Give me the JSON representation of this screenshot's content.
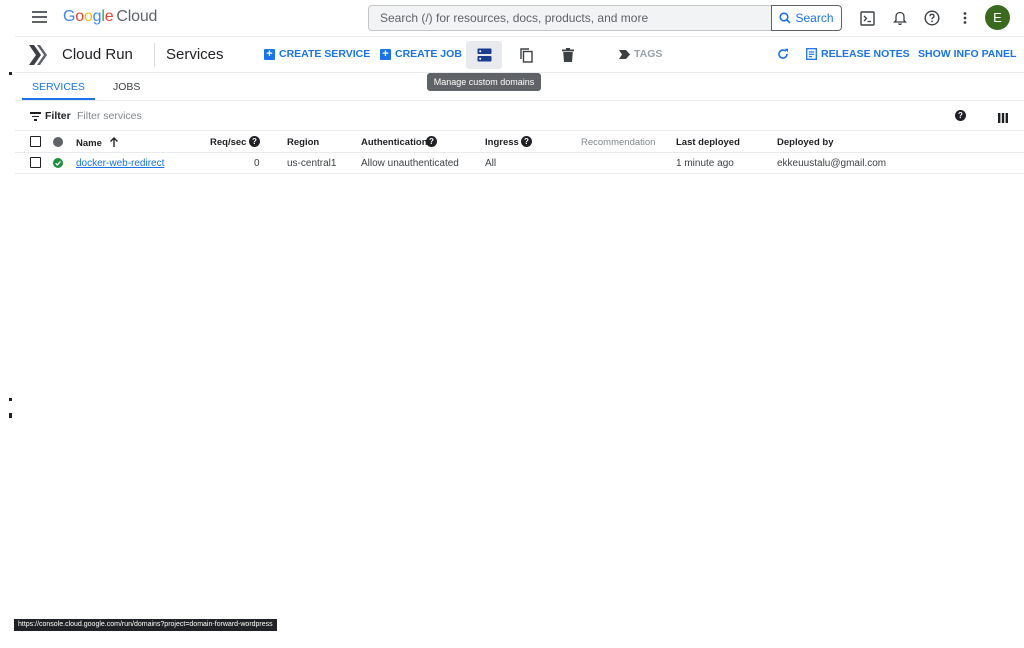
{
  "topbar": {
    "logo_letters": [
      "G",
      "o",
      "o",
      "g",
      "l",
      "e"
    ],
    "logo_cloud": "Cloud",
    "search_placeholder": "Search (/) for resources, docs, products, and more",
    "search_button": "Search",
    "avatar_initial": "E"
  },
  "header": {
    "product_name": "Cloud Run",
    "page_title": "Services",
    "create_service": "CREATE SERVICE",
    "create_job": "CREATE JOB",
    "tags": "TAGS",
    "release_notes": "RELEASE NOTES",
    "show_info_panel": "SHOW INFO PANEL"
  },
  "tooltip": "Manage custom domains",
  "tabs": [
    {
      "label": "SERVICES",
      "active": true
    },
    {
      "label": "JOBS",
      "active": false
    }
  ],
  "filter": {
    "label": "Filter",
    "placeholder": "Filter services"
  },
  "table": {
    "columns": {
      "name": "Name",
      "req_sec": "Req/sec",
      "region": "Region",
      "authentication": "Authentication",
      "ingress": "Ingress",
      "recommendation": "Recommendation",
      "last_deployed": "Last deployed",
      "deployed_by": "Deployed by"
    },
    "rows": [
      {
        "name": "docker-web-redirect",
        "req_sec": "0",
        "region": "us-central1",
        "authentication": "Allow unauthenticated",
        "ingress": "All",
        "recommendation": "",
        "last_deployed": "1 minute ago",
        "deployed_by": "ekkeuustalu@gmail.com"
      }
    ]
  },
  "status_url": "https://console.cloud.google.com/run/domains?project=domain-forward-wordpress",
  "colors": {
    "accent": "#1a73e8",
    "success": "#1e8e3e",
    "avatar": "#3a6a1e",
    "tooltip_bg": "#5f6368"
  }
}
